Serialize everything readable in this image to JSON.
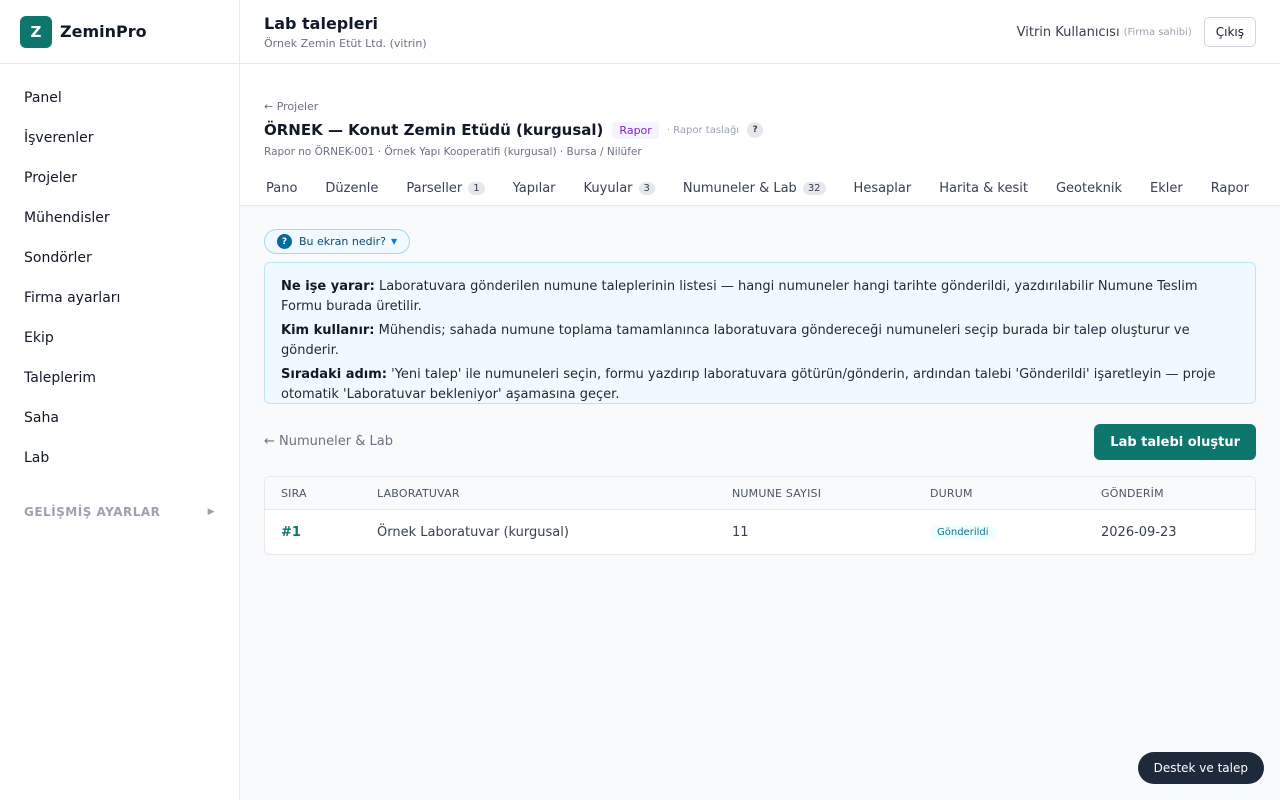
{
  "brand": {
    "logo_letter": "Z",
    "name": "ZeminPro"
  },
  "sidebar": {
    "items": [
      {
        "label": "Panel"
      },
      {
        "label": "İşverenler"
      },
      {
        "label": "Projeler"
      },
      {
        "label": "Mühendisler"
      },
      {
        "label": "Sondörler"
      },
      {
        "label": "Firma ayarları"
      },
      {
        "label": "Ekip"
      },
      {
        "label": "Taleplerim"
      },
      {
        "label": "Saha"
      },
      {
        "label": "Lab"
      }
    ],
    "advanced_label": "GELİŞMİŞ AYARLAR",
    "advanced_arrow": "▶"
  },
  "topbar": {
    "title": "Lab talepleri",
    "subtitle": "Örnek Zemin Etüt Ltd. (vitrin)",
    "user_name": "Vitrin Kullanıcısı",
    "user_role": "(Firma sahibi)",
    "logout_label": "Çıkış"
  },
  "project": {
    "back_label": "← Projeler",
    "title": "ÖRNEK — Konut Zemin Etüdü (kurgusal)",
    "badge": "Rapor",
    "stage": "· Rapor taslağı",
    "help_glyph": "?",
    "meta": "Rapor no ÖRNEK-001 · Örnek Yapı Kooperatifi (kurgusal) · Bursa / Nilüfer",
    "tabs": [
      {
        "label": "Pano",
        "count": ""
      },
      {
        "label": "Düzenle",
        "count": ""
      },
      {
        "label": "Parseller",
        "count": "1"
      },
      {
        "label": "Yapılar",
        "count": ""
      },
      {
        "label": "Kuyular",
        "count": "3"
      },
      {
        "label": "Numuneler & Lab",
        "count": "32"
      },
      {
        "label": "Hesaplar",
        "count": ""
      },
      {
        "label": "Harita & kesit",
        "count": ""
      },
      {
        "label": "Geoteknik",
        "count": ""
      },
      {
        "label": "Ekler",
        "count": ""
      },
      {
        "label": "Rapor",
        "count": ""
      }
    ]
  },
  "help": {
    "toggle_glyph": "?",
    "toggle_label": "Bu ekran nedir?",
    "toggle_caret": "▼",
    "what_label": "Ne işe yarar:",
    "what_text": "Laboratuvara gönderilen numune taleplerinin listesi — hangi numuneler hangi tarihte gönderildi, yazdırılabilir Numune Teslim Formu burada üretilir.",
    "who_label": "Kim kullanır:",
    "who_text": "Mühendis; sahada numune toplama tamamlanınca laboratuvara göndereceği numuneleri seçip burada bir talep oluşturur ve gönderir.",
    "next_label": "Sıradaki adım:",
    "next_text": "'Yeni talep' ile numuneleri seçin, formu yazdırıp laboratuvara götürün/gönderin, ardından talebi 'Gönderildi' işaretleyin — proje otomatik 'Laboratuvar bekleniyor' aşamasına geçer."
  },
  "actions": {
    "back_label": "← Numuneler & Lab",
    "create_label": "Lab talebi oluştur"
  },
  "table": {
    "headers": [
      "SIRA",
      "LABORATUVAR",
      "NUMUNE SAYISI",
      "DURUM",
      "GÖNDERİM"
    ],
    "rows": [
      {
        "seq": "#1",
        "lab": "Örnek Laboratuvar (kurgusal)",
        "count": "11",
        "status": "Gönderildi",
        "date": "2026-09-23"
      }
    ]
  },
  "support": {
    "label": "Destek ve talep"
  }
}
